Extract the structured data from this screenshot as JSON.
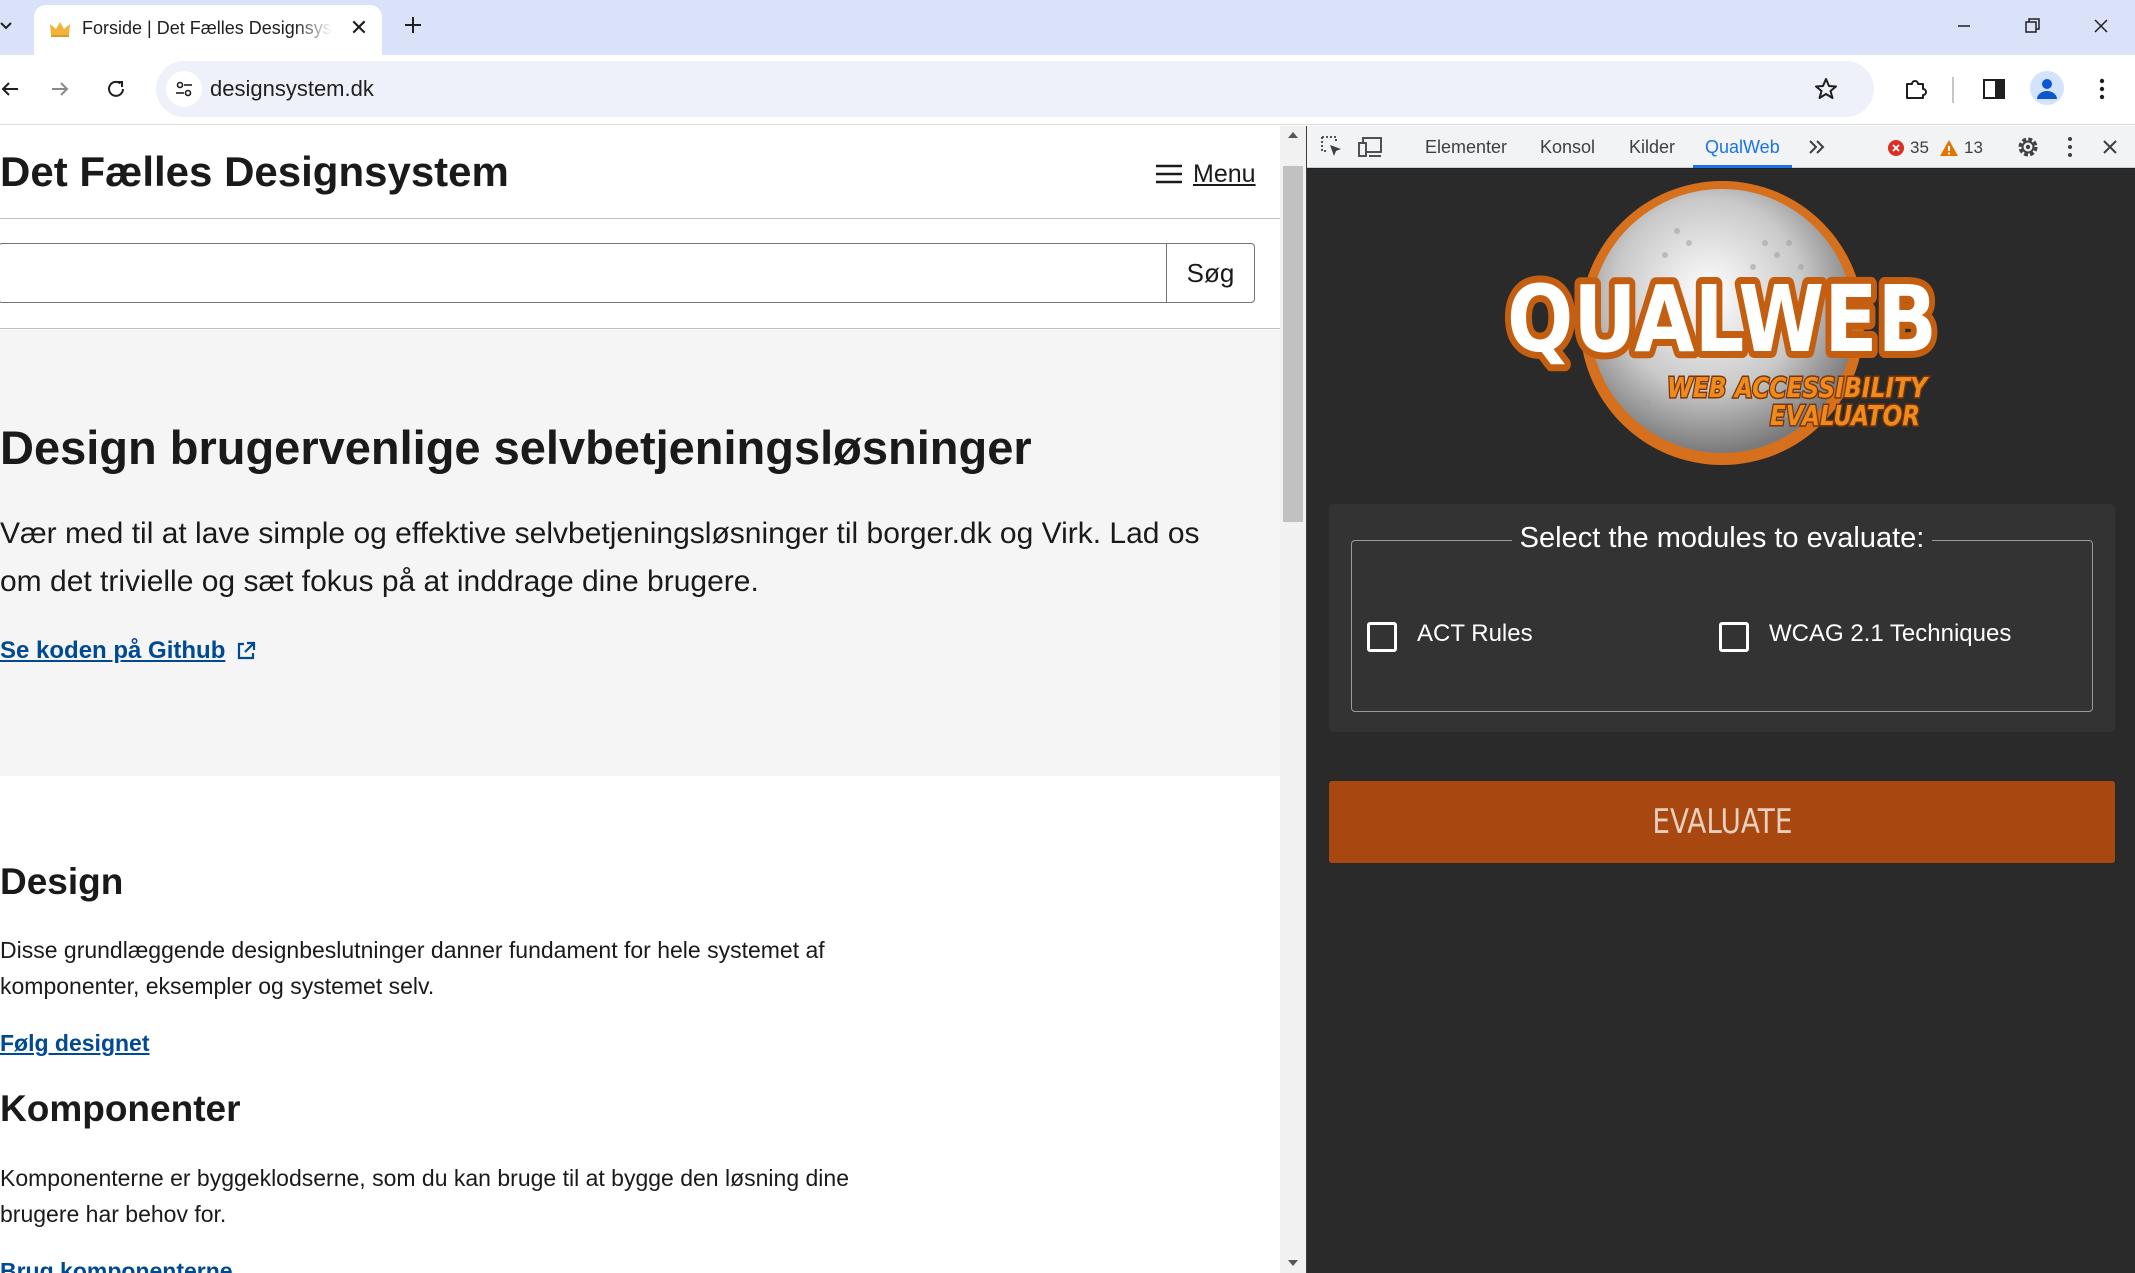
{
  "browser": {
    "tab": {
      "title": "Forside | Det Fælles Designsystem"
    },
    "address": {
      "url": "designsystem.dk"
    }
  },
  "page": {
    "header": {
      "site_title": "Det Fælles Designsystem",
      "menu_label": "Menu"
    },
    "search": {
      "button_label": "Søg",
      "value": ""
    },
    "hero": {
      "title": "Design brugervenlige selvbetjeningsløsninger",
      "text": "Vær med til at lave simple og effektive selvbetjeningsløsninger til borger.dk og Virk. Lad os om det trivielle og sæt fokus på at inddrage dine brugere.",
      "link": "Se koden på Github"
    },
    "sections": [
      {
        "title": "Design",
        "text": "Disse grundlæggende designbeslutninger danner fundament for hele systemet af komponenter, eksempler og systemet selv.",
        "link": "Følg designet"
      },
      {
        "title": "Komponenter",
        "text": "Komponenterne er byggeklodserne, som du kan bruge til at bygge den løsning dine brugere har behov for.",
        "link": "Brug komponenterne"
      }
    ]
  },
  "devtools": {
    "tabs": [
      "Elementer",
      "Konsol",
      "Kilder",
      "QualWeb"
    ],
    "active_tab": "QualWeb",
    "errors": "35",
    "warnings": "13",
    "qualweb": {
      "logo_text": "QUALWEB",
      "logo_subtext_1": "WEB ACCESSIBILITY",
      "logo_subtext_2": "EVALUATOR",
      "modules_legend": "Select the modules to evaluate:",
      "modules": [
        {
          "label": "ACT Rules",
          "checked": false
        },
        {
          "label": "WCAG 2.1 Techniques",
          "checked": false
        }
      ],
      "evaluate_label": "EVALUATE"
    }
  },
  "colors": {
    "link": "#004993",
    "evaluate_button": "#a8470f",
    "devtools_active": "#1a73e8",
    "logo_orange": "#e8811f"
  }
}
